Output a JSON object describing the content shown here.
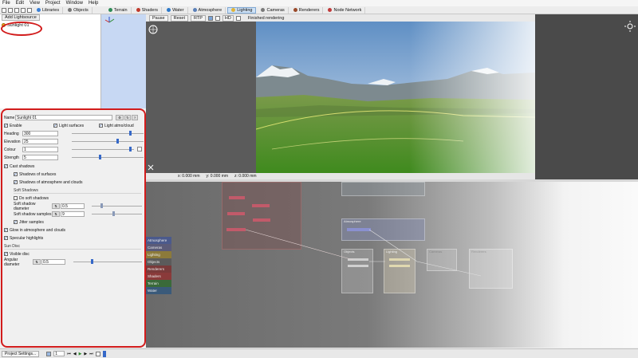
{
  "menu": [
    "File",
    "Edit",
    "View",
    "Project",
    "Window",
    "Help"
  ],
  "toolbar": {
    "tabs": [
      {
        "label": "Libraries",
        "color": "#3a7fd5"
      },
      {
        "label": "Objects",
        "color": "#777777"
      },
      {
        "label": "Terrain",
        "color": "#2e8b57"
      },
      {
        "label": "Shaders",
        "color": "#c0392b"
      },
      {
        "label": "Water",
        "color": "#2d78c8"
      },
      {
        "label": "Atmosphere",
        "color": "#5a7fb8"
      },
      {
        "label": "Lighting",
        "color": "#e0b43a",
        "active": true
      },
      {
        "label": "Cameras",
        "color": "#7a7a7a"
      },
      {
        "label": "Renderers",
        "color": "#9a4a2a"
      },
      {
        "label": "Node Network",
        "color": "#c03a3a"
      }
    ]
  },
  "lights": {
    "add_button": "Add Lightsource",
    "items": [
      {
        "label": "Sunlight 01"
      }
    ]
  },
  "viewport": {
    "buttons": [
      "Pause",
      "Reset",
      "RTP",
      "HD"
    ],
    "status": "Finished rendering",
    "coords": [
      "x: 0.000 mm",
      "y: 0.000 mm",
      "z: 0.000 mm"
    ]
  },
  "settings": {
    "name_label": "Name",
    "name_value": "Sunlight 01",
    "enable": "Enable",
    "light_surfaces": "Light surfaces",
    "light_atmo": "Light atmo/cloud",
    "heading": {
      "label": "Heading",
      "value": "300"
    },
    "elevation": {
      "label": "Elevation",
      "value": "25"
    },
    "colour": {
      "label": "Colour",
      "value": "1"
    },
    "strength": {
      "label": "Strength",
      "value": "5"
    },
    "cast_shadows": "Cast shadows",
    "shadows_surfaces": "Shadows of surfaces",
    "shadows_atmo": "Shadows of atmosphere and clouds",
    "soft_shadows_header": "Soft Shadows",
    "do_soft": "Do soft shadows",
    "soft_diameter": {
      "label": "Soft shadow diameter",
      "value": "0.5"
    },
    "soft_samples": {
      "label": "Soft shadow samples",
      "value": "9"
    },
    "jitter": "Jitter samples",
    "glow": "Glow in atmosphere and clouds",
    "specular": "Specular highlights",
    "sun_disc_header": "Sun Disc",
    "visible_disc": "Visible disc",
    "angular": {
      "label": "Angular diameter",
      "value": "0.5"
    }
  },
  "node_categories": [
    {
      "label": "Atmosphere",
      "color": "#4b5a8c"
    },
    {
      "label": "Cameras",
      "color": "#5b5b78"
    },
    {
      "label": "Lighting",
      "color": "#8c7a3a"
    },
    {
      "label": "Objects",
      "color": "#5b5b5b"
    },
    {
      "label": "Renderers",
      "color": "#7a3a3a"
    },
    {
      "label": "Shaders",
      "color": "#8a3a3a"
    },
    {
      "label": "Terrain",
      "color": "#3a6a3a"
    },
    {
      "label": "Water",
      "color": "#3a5a7a"
    }
  ],
  "nodes": {
    "atmo_group": "Atmosphere",
    "groups": [
      "Objects",
      "Lighting",
      "Cameras",
      "Renderers"
    ]
  },
  "statusbar": {
    "project_settings": "Project Settings...",
    "frame": "1"
  }
}
